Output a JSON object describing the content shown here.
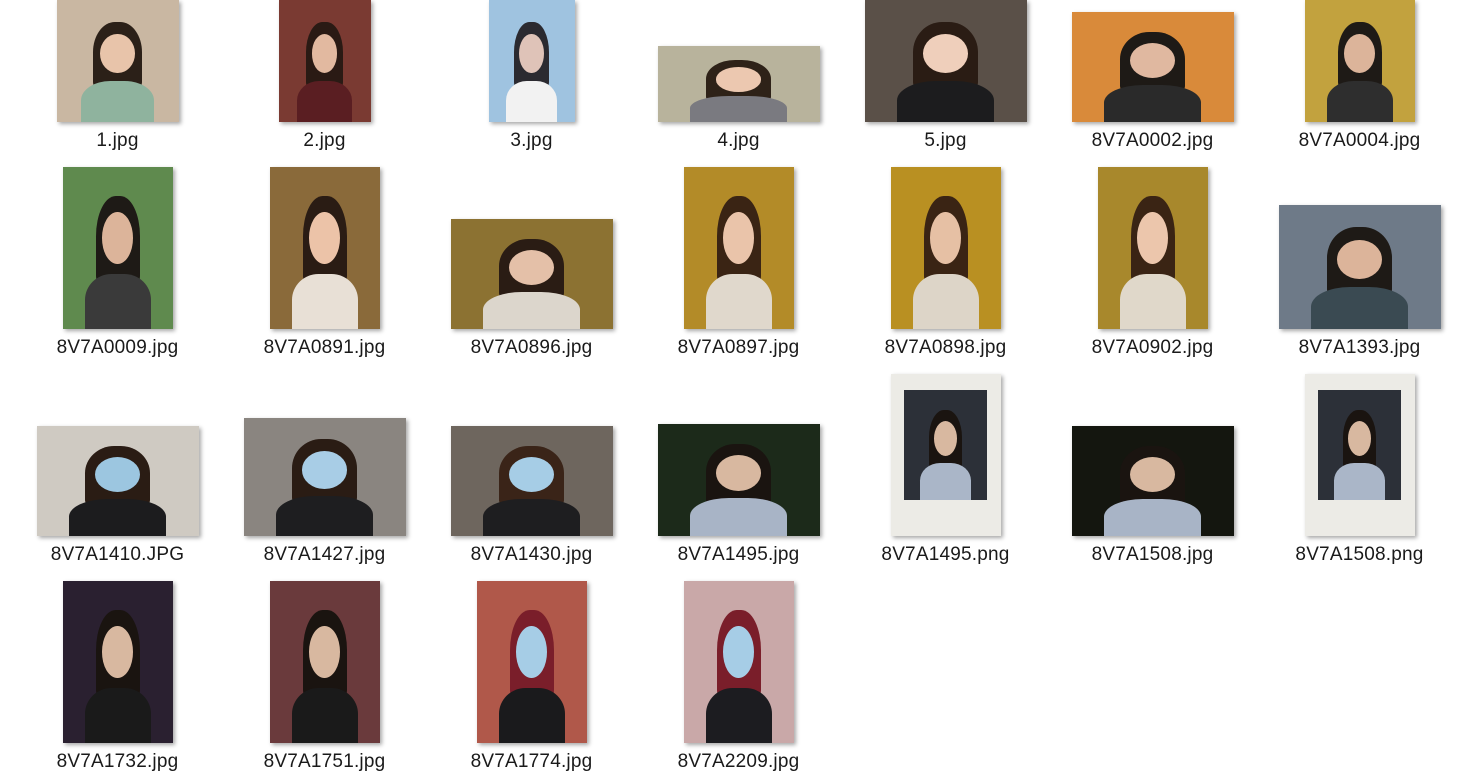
{
  "window": {
    "view": "large-icons"
  },
  "files": [
    {
      "name": "1.jpg",
      "bg": "#c9b7a2",
      "hair": "#2b2018",
      "skin": "#e8c4aa",
      "cloth": "#8fb39e"
    },
    {
      "name": "2.jpg",
      "bg": "#7a3a32",
      "hair": "#2a1a14",
      "skin": "#e2b9a0",
      "cloth": "#5a1e22"
    },
    {
      "name": "3.jpg",
      "bg": "#9fc3e0",
      "hair": "#2b2a30",
      "skin": "#dfc3b8",
      "cloth": "#f2f2f2"
    },
    {
      "name": "4.jpg",
      "bg": "#b8b39c",
      "hair": "#2e2218",
      "skin": "#ecc8b0",
      "cloth": "#7a7a80"
    },
    {
      "name": "5.jpg",
      "bg": "#5a5048",
      "hair": "#2a1c14",
      "skin": "#efcfbb",
      "cloth": "#1c1c1e"
    },
    {
      "name": "8V7A0002.jpg",
      "bg": "#d98a3a",
      "hair": "#1e1a16",
      "skin": "#e0b8a0",
      "cloth": "#2a2a2a"
    },
    {
      "name": "8V7A0004.jpg",
      "bg": "#c2a23e",
      "hair": "#1e1a16",
      "skin": "#dcb49a",
      "cloth": "#2e2e2e"
    },
    {
      "name": "8V7A0009.jpg",
      "bg": "#5f8a4e",
      "hair": "#1e1a16",
      "skin": "#dcb49a",
      "cloth": "#3a3a3a"
    },
    {
      "name": "8V7A0891.jpg",
      "bg": "#8a6a3a",
      "hair": "#2a1c14",
      "skin": "#ecc3a8",
      "cloth": "#e8e0d6"
    },
    {
      "name": "8V7A0896.jpg",
      "bg": "#8c7232",
      "hair": "#2a1c14",
      "skin": "#e4c0a8",
      "cloth": "#dcd6cc"
    },
    {
      "name": "8V7A0897.jpg",
      "bg": "#b38b28",
      "hair": "#3a2414",
      "skin": "#eac4aa",
      "cloth": "#e0d8cc"
    },
    {
      "name": "8V7A0898.jpg",
      "bg": "#b99022",
      "hair": "#3a2414",
      "skin": "#e6c0a4",
      "cloth": "#ddd5c8"
    },
    {
      "name": "8V7A0902.jpg",
      "bg": "#a8882c",
      "hair": "#3a2414",
      "skin": "#ecc6ac",
      "cloth": "#e0d8ca"
    },
    {
      "name": "8V7A1393.jpg",
      "bg": "#6e7a88",
      "hair": "#1e1a16",
      "skin": "#dcb49a",
      "cloth": "#3a4a52"
    },
    {
      "name": "8V7A1410.JPG",
      "bg": "#cfcac2",
      "hair": "#2a1c14",
      "skin": "#9cc6e0",
      "cloth": "#1c1c1e"
    },
    {
      "name": "8V7A1427.jpg",
      "bg": "#8a8580",
      "hair": "#2a1c14",
      "skin": "#a8cde6",
      "cloth": "#1e1e20"
    },
    {
      "name": "8V7A1430.jpg",
      "bg": "#6e665e",
      "hair": "#3a2418",
      "skin": "#a6cde6",
      "cloth": "#1e1e20"
    },
    {
      "name": "8V7A1495.jpg",
      "bg": "#1c2a1a",
      "hair": "#1a1410",
      "skin": "#d8b8a0",
      "cloth": "#a8b4c6"
    },
    {
      "name": "8V7A1495.png",
      "bg": "#ecebe6",
      "hair": "#1a1410",
      "skin": "#d8b8a0",
      "cloth": "#aab6c8"
    },
    {
      "name": "8V7A1508.jpg",
      "bg": "#14160f",
      "hair": "#1a1410",
      "skin": "#d8b8a0",
      "cloth": "#a8b4c6"
    },
    {
      "name": "8V7A1508.png",
      "bg": "#ecebe6",
      "hair": "#1a1410",
      "skin": "#d8b8a0",
      "cloth": "#aab6c8"
    },
    {
      "name": "8V7A1732.jpg",
      "bg": "#2a2030",
      "hair": "#1a1410",
      "skin": "#d8b8a0",
      "cloth": "#1a1a1a"
    },
    {
      "name": "8V7A1751.jpg",
      "bg": "#6a3a3c",
      "hair": "#1a1410",
      "skin": "#d8b8a0",
      "cloth": "#1a1a1a"
    },
    {
      "name": "8V7A1774.jpg",
      "bg": "#b0584a",
      "hair": "#7a1e2a",
      "skin": "#a6cde6",
      "cloth": "#1a1a1c"
    },
    {
      "name": "8V7A2209.jpg",
      "bg": "#c9a8a8",
      "hair": "#7a1e2a",
      "skin": "#a6cde6",
      "cloth": "#1c1c20"
    }
  ]
}
